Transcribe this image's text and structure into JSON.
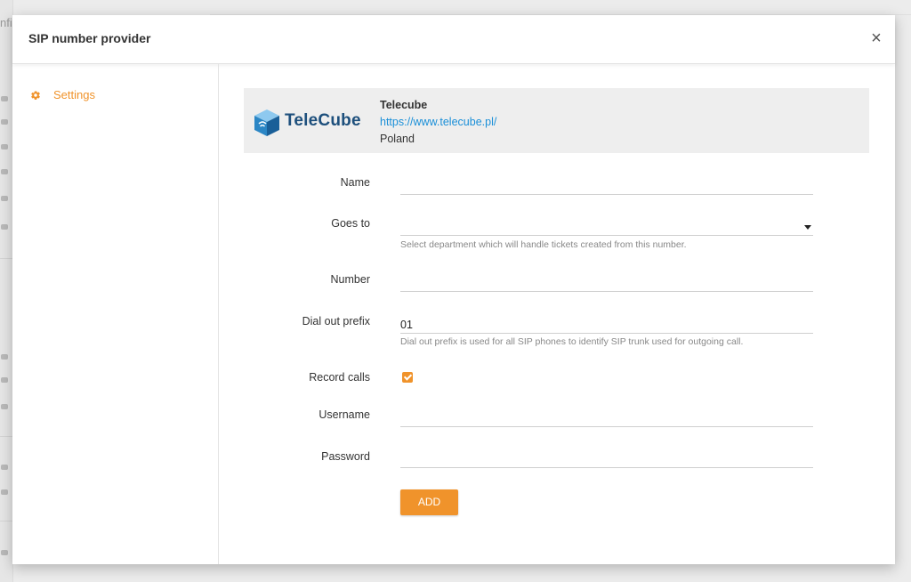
{
  "background": {
    "title_fragment": "nfi"
  },
  "modal": {
    "title": "SIP number provider",
    "close_icon": "close-icon",
    "close_glyph": "×"
  },
  "sidebar": {
    "items": [
      {
        "label": "Settings",
        "icon": "gear-icon",
        "active": true,
        "color": "#f0932b"
      }
    ]
  },
  "provider": {
    "logo_text": "TeleCube",
    "name": "Telecube",
    "url": "https://www.telecube.pl/",
    "country": "Poland"
  },
  "form": {
    "name": {
      "label": "Name",
      "value": ""
    },
    "goes_to": {
      "label": "Goes to",
      "value": "",
      "help": "Select department which will handle tickets created from this number."
    },
    "number": {
      "label": "Number",
      "value": ""
    },
    "dial_out_prefix": {
      "label": "Dial out prefix",
      "value": "01",
      "help": "Dial out prefix is used for all SIP phones to identify SIP trunk used for outgoing call."
    },
    "record_calls": {
      "label": "Record calls",
      "checked": true
    },
    "username": {
      "label": "Username",
      "value": ""
    },
    "password": {
      "label": "Password",
      "value": ""
    },
    "submit_label": "ADD"
  },
  "colors": {
    "accent": "#f0932b",
    "link": "#1a8fd8"
  }
}
